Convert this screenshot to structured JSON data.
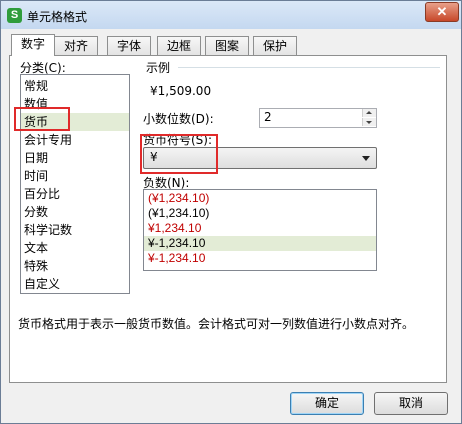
{
  "window": {
    "title": "单元格格式",
    "app_icon_letter": "S",
    "close_glyph": "✕"
  },
  "tabs": [
    {
      "label": "数字",
      "active": true
    },
    {
      "label": "对齐"
    },
    {
      "label": "字体"
    },
    {
      "label": "边框"
    },
    {
      "label": "图案"
    },
    {
      "label": "保护"
    }
  ],
  "category": {
    "label": "分类(C):",
    "items": [
      "常规",
      "数值",
      "货币",
      "会计专用",
      "日期",
      "时间",
      "百分比",
      "分数",
      "科学记数",
      "文本",
      "特殊",
      "自定义"
    ],
    "selected_index": 2
  },
  "sample": {
    "label": "示例",
    "value": "¥1,509.00"
  },
  "decimal": {
    "label": "小数位数(D):",
    "value": "2"
  },
  "currency": {
    "label": "货币符号(S):",
    "value": "¥"
  },
  "negative": {
    "label": "负数(N):",
    "items": [
      {
        "text": "(¥1,234.10)",
        "red": true
      },
      {
        "text": "(¥1,234.10)",
        "red": false
      },
      {
        "text": "¥1,234.10",
        "red": true
      },
      {
        "text": "¥-1,234.10",
        "red": false
      },
      {
        "text": "¥-1,234.10",
        "red": true
      }
    ],
    "selected_index": 3
  },
  "description": "货币格式用于表示一般货币数值。会计格式可对一列数值进行小数点对齐。",
  "buttons": {
    "ok": "确定",
    "cancel": "取消"
  },
  "colors": {
    "highlight_box": "#e02a2a",
    "selection": "#e3ecd6",
    "negative_red": "#c00000"
  }
}
